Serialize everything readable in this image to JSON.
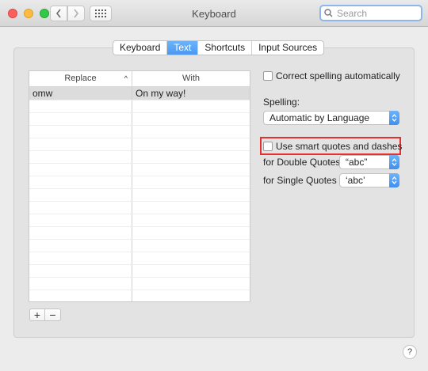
{
  "window": {
    "title": "Keyboard"
  },
  "search": {
    "placeholder": "Search"
  },
  "tabs": [
    {
      "label": "Keyboard",
      "active": false
    },
    {
      "label": "Text",
      "active": true
    },
    {
      "label": "Shortcuts",
      "active": false
    },
    {
      "label": "Input Sources",
      "active": false
    }
  ],
  "table": {
    "headers": {
      "replace": "Replace",
      "with": "With"
    },
    "rows": [
      {
        "replace": "omw",
        "with": "On my way!",
        "selected": true
      }
    ]
  },
  "buttons": {
    "add": "+",
    "remove": "−",
    "help": "?"
  },
  "options": {
    "correct_spelling": {
      "label": "Correct spelling automatically",
      "checked": false
    },
    "spelling_label": "Spelling:",
    "spelling_value": "Automatic by Language",
    "smart_quotes": {
      "label": "Use smart quotes and dashes",
      "checked": false
    },
    "double_quotes_label": "for Double Quotes",
    "double_quotes_value": "“abc”",
    "single_quotes_label": "for Single Quotes",
    "single_quotes_value": "‘abc’"
  },
  "colors": {
    "accent": "#4a98f0",
    "highlight": "#e53030"
  }
}
